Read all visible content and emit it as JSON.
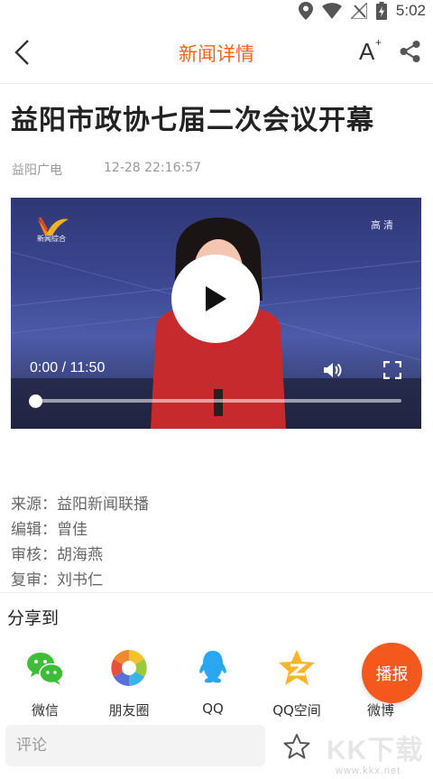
{
  "status_bar": {
    "time": "5:02",
    "icons": [
      "location-icon",
      "wifi-icon",
      "no-signal-icon",
      "battery-charging-icon"
    ]
  },
  "app_bar": {
    "title": "新闻详情",
    "back_icon": "chevron-left-icon",
    "font_size_label": "A",
    "font_size_sup": "+",
    "share_icon": "share-icon"
  },
  "article": {
    "title": "益阳市政协七届二次会议开幕",
    "source": "益阳广电",
    "datetime": "12-28 22:16:57"
  },
  "video": {
    "channel_logo_text": "新闻综合",
    "quality_badge": "高清",
    "current_time": "0:00",
    "separator": " / ",
    "duration": "11:50",
    "progress": 0.0,
    "play_icon": "play-icon",
    "volume_icon": "volume-icon",
    "fullscreen_icon": "fullscreen-icon"
  },
  "credits": [
    {
      "label": "来源：",
      "value": "益阳新闻联播"
    },
    {
      "label": "编辑：",
      "value": "曾佳"
    },
    {
      "label": "审核：",
      "value": "胡海燕"
    },
    {
      "label": "复审：",
      "value": "刘书仁"
    }
  ],
  "share": {
    "title": "分享到",
    "targets": [
      {
        "label": "微信",
        "icon": "wechat-icon",
        "color": "#3fbd39"
      },
      {
        "label": "朋友圈",
        "icon": "moments-icon",
        "color": "#f2a33a"
      },
      {
        "label": "QQ",
        "icon": "qq-icon",
        "color": "#2aa7f0"
      },
      {
        "label": "QQ空间",
        "icon": "qzone-icon",
        "color": "#f7b52c"
      },
      {
        "label": "微博",
        "icon": "weibo-icon",
        "color": "#e6162d"
      }
    ]
  },
  "fab": {
    "label": "播报",
    "color": "#f4581d"
  },
  "bottom_bar": {
    "comment_placeholder": "评论",
    "favorite_icon": "star-outline-icon"
  },
  "watermark": {
    "main": "KK下载",
    "url": "www.kkx.net"
  },
  "colors": {
    "accent": "#f06422",
    "text_primary": "#222222",
    "text_secondary": "#999999"
  }
}
